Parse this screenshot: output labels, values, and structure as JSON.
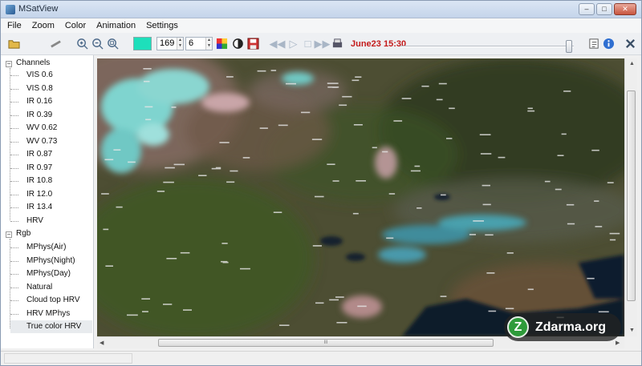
{
  "window": {
    "title": "MSatView",
    "minimize": "–",
    "maximize": "□",
    "close": "✕"
  },
  "menu": [
    "File",
    "Zoom",
    "Color",
    "Animation",
    "Settings"
  ],
  "toolbar": {
    "color_value": "#1ddfbb",
    "channel_value": "169",
    "step_value": "6",
    "datetime": "June23 15:30",
    "icons": [
      "open-folder",
      "satellite",
      "zoom-in",
      "zoom-out",
      "zoom-fit",
      "color-swatch",
      "palette",
      "contrast",
      "save",
      "rewind",
      "play",
      "stop",
      "fast-forward",
      "print",
      "edit",
      "info",
      "close"
    ]
  },
  "sidebar": {
    "channels_label": "Channels",
    "channels": [
      "VIS 0.6",
      "VIS 0.8",
      "IR 0.16",
      "IR 0.39",
      "WV 0.62",
      "WV 0.73",
      "IR 0.87",
      "IR 0.97",
      "IR 10.8",
      "IR 12.0",
      "IR 13.4",
      "HRV"
    ],
    "rgb_label": "Rgb",
    "rgb": [
      "MPhys(Air)",
      "MPhys(Night)",
      "MPhys(Day)",
      "Natural",
      "Cloud top HRV",
      "HRV MPhys",
      "True color HRV"
    ],
    "selected": "True color HRV"
  },
  "map": {
    "land_color": "#4d4e33",
    "snow_color": "#7fd4cf",
    "sea_color": "#0e1a2c"
  },
  "scrollbar": {
    "grip": "III"
  },
  "watermark": {
    "text": "Zdarma.org",
    "logo_letter": "Z"
  }
}
